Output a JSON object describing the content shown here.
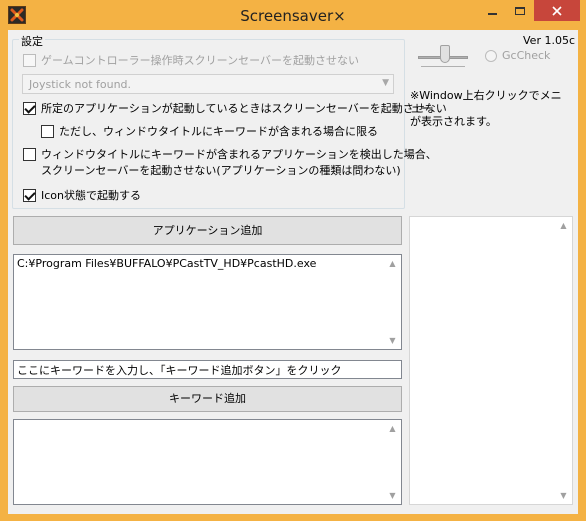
{
  "window": {
    "title": "Screensaver×",
    "accent": "#f4b244",
    "close_color": "#c7463b"
  },
  "settings": {
    "group_label": "設定",
    "gamecontroller_label": "ゲームコントローラー操作時スクリーンセーバーを起動させない",
    "gamecontroller_checked": false,
    "joystick_value": "Joystick not found.",
    "app_running_label": "所定のアプリケーションが起動しているときはスクリーンセーバーを起動させない",
    "app_running_checked": true,
    "window_title_only_label": "ただし、ウィンドウタイトルにキーワードが含まれる場合に限る",
    "window_title_only_checked": false,
    "detect_keyword_label_line1": "ウィンドウタイトルにキーワードが含まれるアプリケーションを検出した場合、",
    "detect_keyword_label_line2": "スクリーンセーバーを起動させない(アプリケーションの種類は問わない)",
    "detect_keyword_checked": false,
    "icon_state_label": "Icon状態で起動する",
    "icon_state_checked": true
  },
  "right_panel": {
    "version": "Ver 1.05c",
    "gccheck_label": "GcCheck",
    "note_line1": "※Window上右クリックでメニュー",
    "note_line2": "が表示されます。"
  },
  "apps": {
    "add_button_label": "アプリケーション追加",
    "list_text": "C:¥Program Files¥BUFFALO¥PCastTV_HD¥PcastHD.exe"
  },
  "keywords": {
    "input_value": "ここにキーワードを入力し、「キーワード追加ボタン」をクリック",
    "add_button_label": "キーワード追加",
    "list_text": ""
  }
}
